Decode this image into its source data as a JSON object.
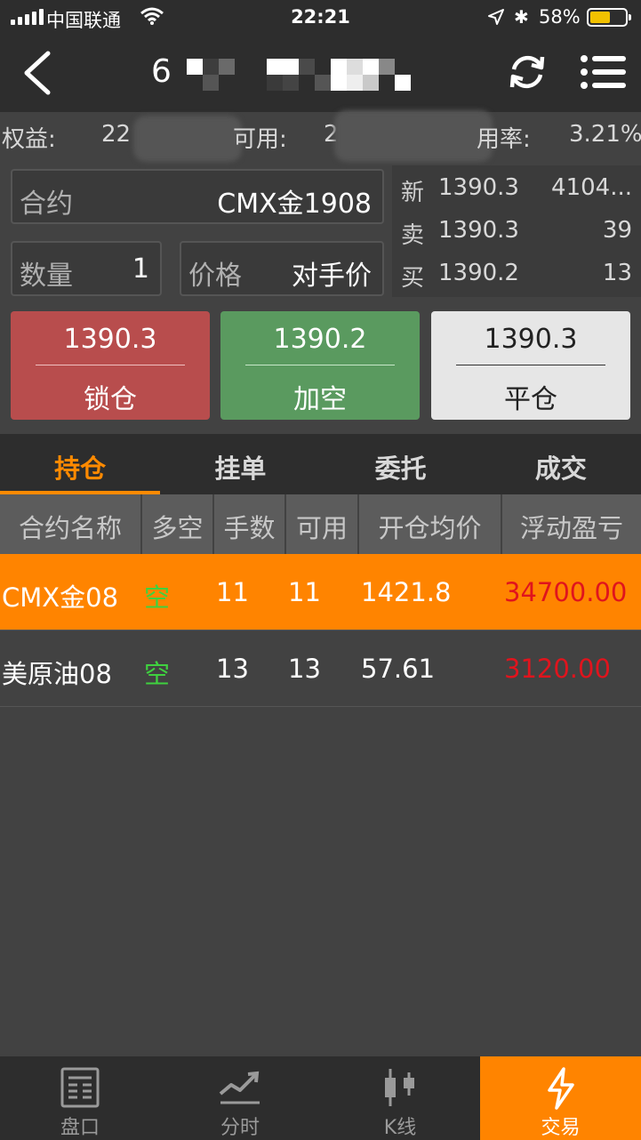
{
  "status_bar": {
    "carrier": "中国联通",
    "time": "22:21",
    "battery": "58%",
    "battery_level": 0.58
  },
  "header": {
    "title_visible": "6"
  },
  "equity": {
    "equity_label": "权益:",
    "equity_value": "22",
    "available_label": "可用:",
    "available_value": "2",
    "usage_label": "用率:",
    "usage_value": "3.21%"
  },
  "order": {
    "contract_label": "合约",
    "contract_value": "CMX金1908",
    "quantity_label": "数量",
    "quantity_value": "1",
    "price_label": "价格",
    "price_value": "对手价"
  },
  "quote": {
    "last_label": "新",
    "last_price": "1390.3",
    "last_volume": "4104...",
    "ask_label": "卖",
    "ask_price": "1390.3",
    "ask_volume": "39",
    "bid_label": "买",
    "bid_price": "1390.2",
    "bid_volume": "13"
  },
  "actions": {
    "lock_price": "1390.3",
    "lock_label": "锁仓",
    "short_price": "1390.2",
    "short_label": "加空",
    "close_price": "1390.3",
    "close_label": "平仓"
  },
  "tabs": [
    "持仓",
    "挂单",
    "委托",
    "成交"
  ],
  "table": {
    "headers": [
      "合约名称",
      "多空",
      "手数",
      "可用",
      "开仓均价",
      "浮动盈亏"
    ],
    "rows": [
      {
        "name": "CMX金08",
        "direction": "空",
        "lots": "11",
        "available": "11",
        "avg_price": "1421.8",
        "pnl": "34700.00"
      },
      {
        "name": "美原油08",
        "direction": "空",
        "lots": "13",
        "available": "13",
        "avg_price": "57.61",
        "pnl": "3120.00"
      }
    ]
  },
  "nav": [
    "盘口",
    "分时",
    "K线",
    "交易"
  ],
  "colors": {
    "accent": "#ff8400",
    "loss_text": "#e0141d",
    "short_green": "#3fd13f",
    "lock_button": "#b84d4d",
    "short_button": "#5a9a5f"
  }
}
